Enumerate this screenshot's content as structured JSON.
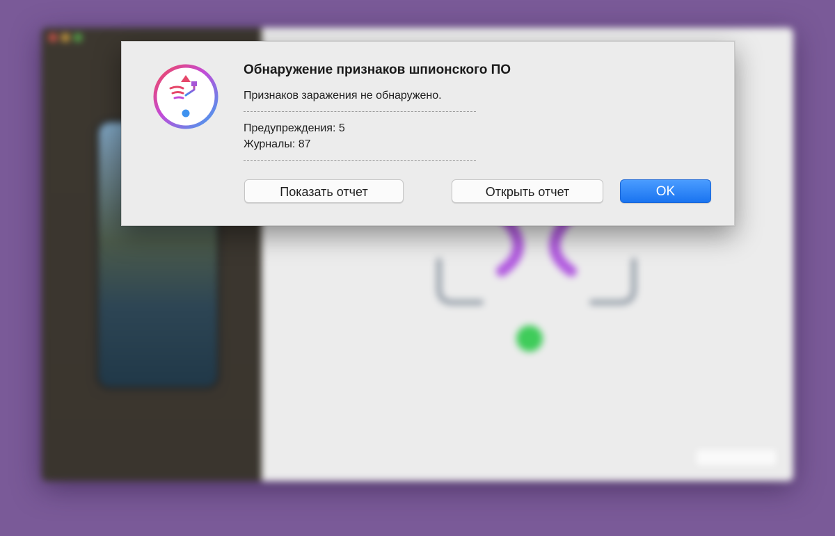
{
  "dialog": {
    "title": "Обнаружение признаков шпионского ПО",
    "message": "Признаков заражения не обнаружено.",
    "warnings": "Предупреждения: 5",
    "logs": "Журналы: 87",
    "buttons": {
      "show_report": "Показать отчет",
      "open_report": "Открыть отчет",
      "ok": "OK"
    },
    "app_icon": "usb-scan-app-icon",
    "accent_color": "#1a74f0"
  },
  "background": {
    "status_color": "#3fcc5a",
    "scan_graphic_color": "#b25be0",
    "sidebar_color": "#3f3a33"
  }
}
